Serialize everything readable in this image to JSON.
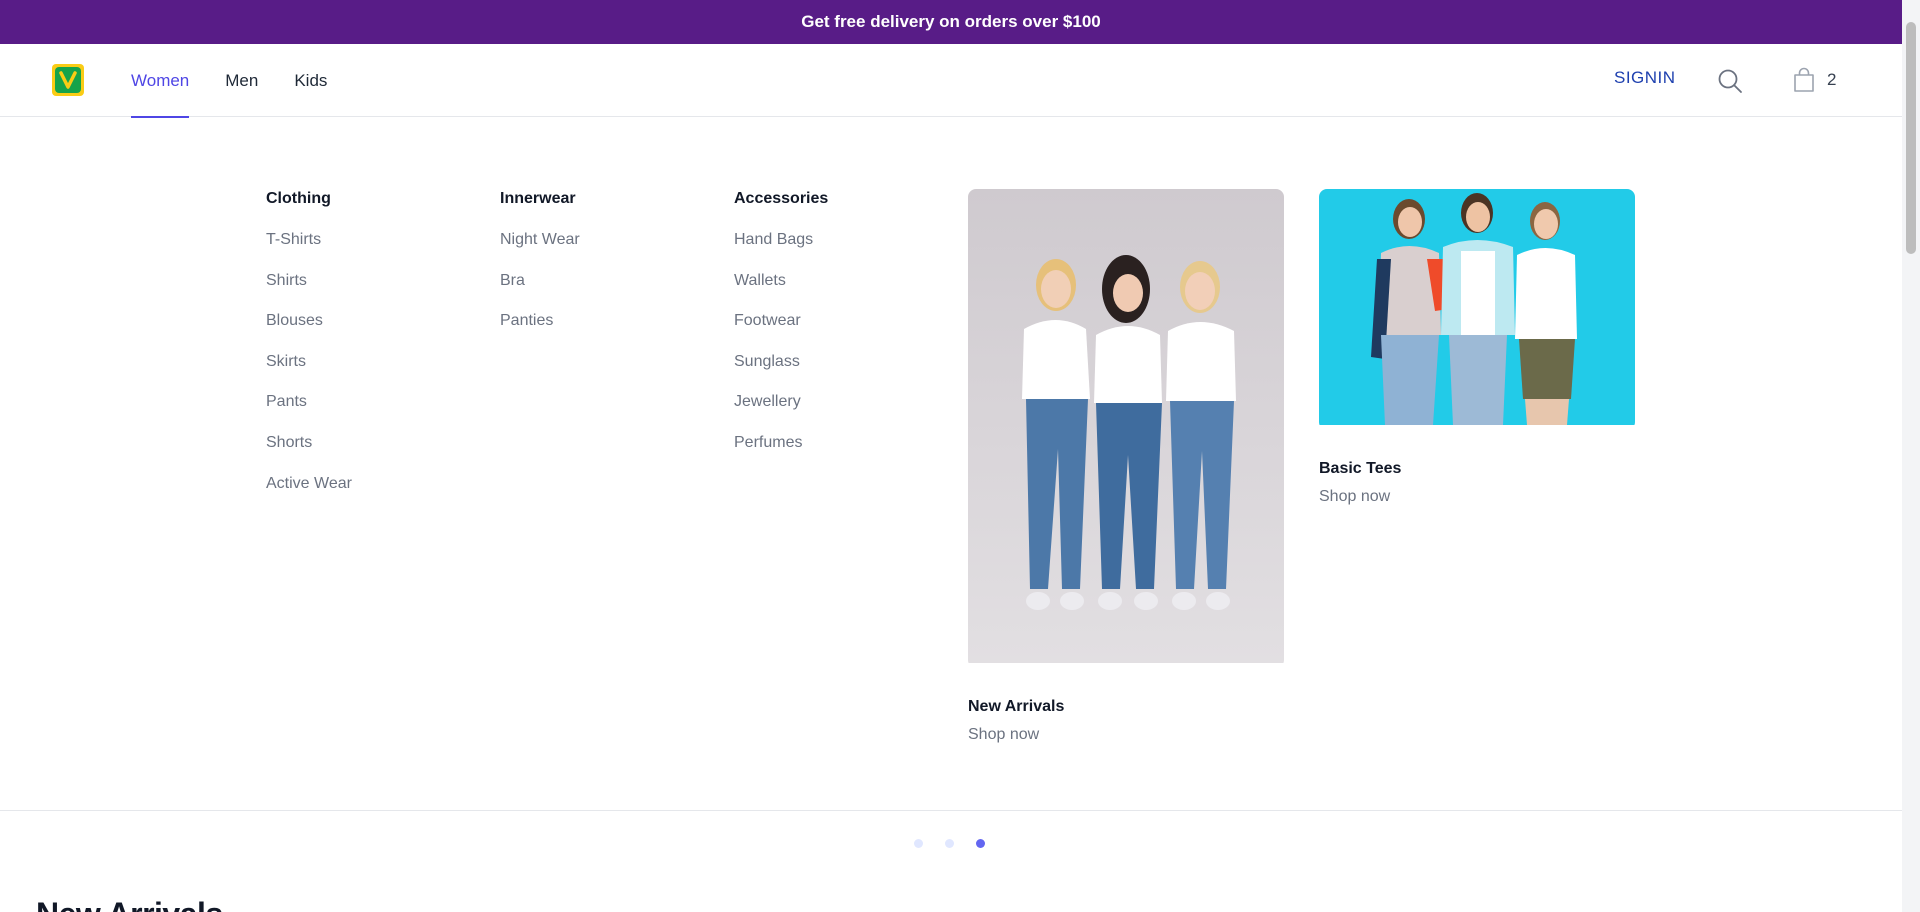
{
  "promo_bar": {
    "text": "Get free delivery on orders over $100"
  },
  "header": {
    "logo": {
      "letter": "V",
      "colors": {
        "outer": "#facc15",
        "inner": "#16a34a"
      }
    },
    "nav": [
      {
        "label": "Women",
        "active": true
      },
      {
        "label": "Men",
        "active": false
      },
      {
        "label": "Kids",
        "active": false
      }
    ],
    "signin_label": "SIGNIN",
    "search_icon": "search-icon",
    "cart": {
      "icon": "shopping-bag-icon",
      "count": "2"
    }
  },
  "mega_menu": {
    "columns": [
      {
        "title": "Clothing",
        "items": [
          "T-Shirts",
          "Shirts",
          "Blouses",
          "Skirts",
          "Pants",
          "Shorts",
          "Active Wear"
        ]
      },
      {
        "title": "Innerwear",
        "items": [
          "Night Wear",
          "Bra",
          "Panties"
        ]
      },
      {
        "title": "Accessories",
        "items": [
          "Hand Bags",
          "Wallets",
          "Footwear",
          "Sunglass",
          "Jewellery",
          "Perfumes"
        ]
      }
    ],
    "promos": [
      {
        "title": "New Arrivals",
        "link": "Shop now",
        "background": "#d1cdd1"
      },
      {
        "title": "Basic Tees",
        "link": "Shop now",
        "background": "#22d3ee"
      }
    ]
  },
  "carousel": {
    "dots": 3,
    "active_index": 2
  },
  "section": {
    "heading": "New Arrivals"
  },
  "colors": {
    "accent": "#4f46e5",
    "promo_bar": "#581c87"
  }
}
